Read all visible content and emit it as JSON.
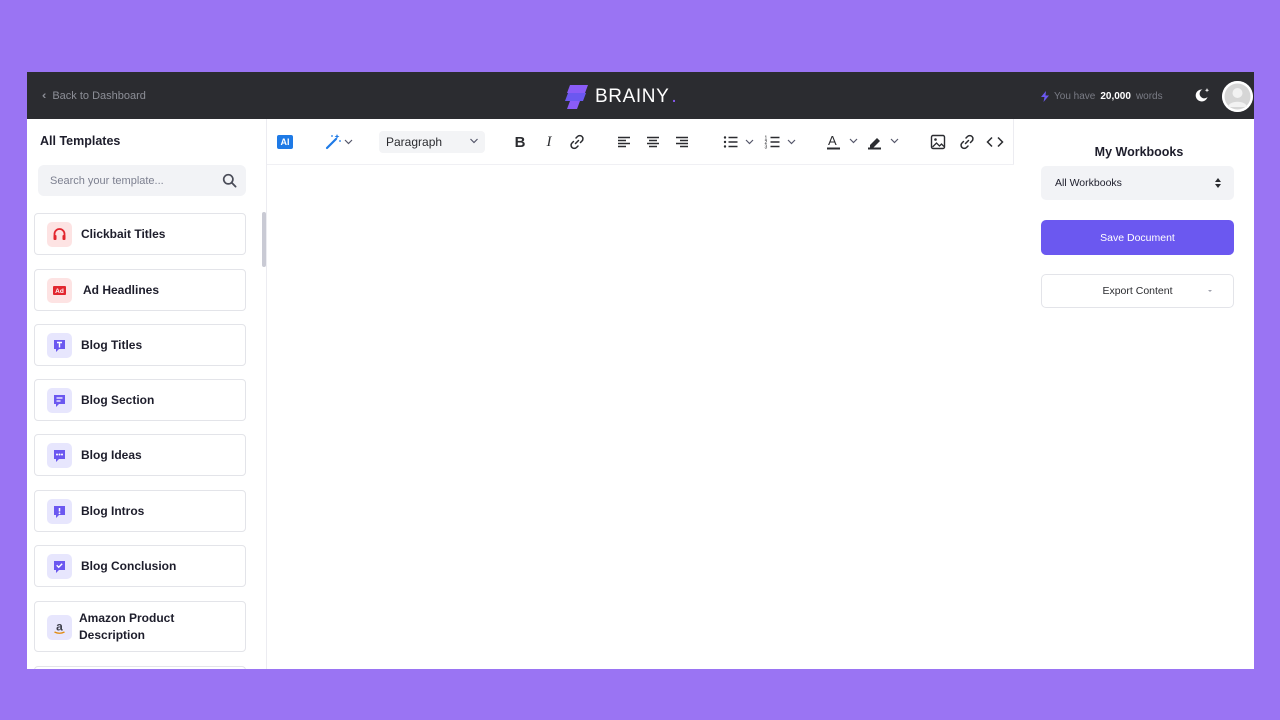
{
  "header": {
    "back_label": "Back to Dashboard",
    "logo_text": "BRAINY",
    "logo_dot": ".",
    "words_prefix": "You have",
    "words_count": "20,000",
    "words_suffix": "words",
    "theme_icon": "moon-sparkle-icon",
    "avatar_icon": "user-avatar-icon"
  },
  "sidebar": {
    "title": "All Templates",
    "search_placeholder": "Search your template...",
    "items": [
      {
        "label": "Clickbait Titles",
        "icon": "headphones-icon"
      },
      {
        "label": "Ad Headlines",
        "icon": "ad-icon"
      },
      {
        "label": "Blog Titles",
        "icon": "title-icon"
      },
      {
        "label": "Blog Section",
        "icon": "message-lines-icon"
      },
      {
        "label": "Blog Ideas",
        "icon": "chat-dots-icon"
      },
      {
        "label": "Blog Intros",
        "icon": "exclamation-icon"
      },
      {
        "label": "Blog Conclusion",
        "icon": "check-message-icon"
      },
      {
        "label": "Amazon Product Description",
        "icon": "amazon-icon"
      }
    ]
  },
  "toolbar": {
    "ai_label": "AI",
    "paragraph_label": "Paragraph"
  },
  "right_panel": {
    "title": "My Workbooks",
    "workbook_select": "All Workbooks",
    "save_label": "Save Document",
    "export_label": "Export Content"
  },
  "colors": {
    "background": "#9a74f3",
    "topbar": "#2b2c30",
    "accent": "#6b58f0",
    "ai_blue": "#1e7ae6"
  }
}
